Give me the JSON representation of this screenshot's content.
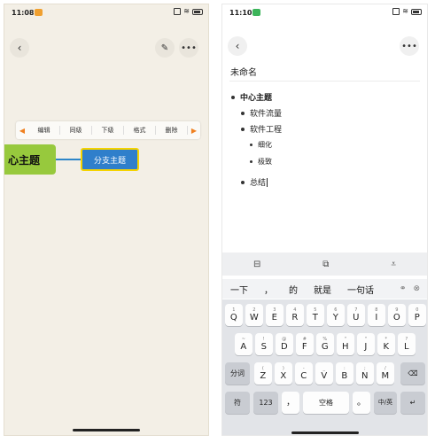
{
  "left_phone": {
    "status": {
      "time": "11:08"
    },
    "toolbar": {
      "items": [
        "编辑",
        "同级",
        "下级",
        "格式",
        "删除"
      ]
    },
    "nodes": {
      "main": "心主题",
      "branch": "分支主题"
    },
    "icons": {
      "back": "chevron-left-icon",
      "style": "brush-icon",
      "more": "more-icon"
    }
  },
  "right_phone": {
    "status": {
      "time": "11:10"
    },
    "doc_title": "未命名",
    "outline": {
      "center": "中心主题",
      "traffic": "软件流量",
      "engineering": "软件工程",
      "refine": "细化",
      "extreme": "极致",
      "summary": "总结"
    },
    "ime_toolbar": [
      "layout-icon",
      "clipboard-icon",
      "collapse-icon"
    ],
    "candidates": [
      "一下",
      "，",
      "的",
      "就是",
      "一句话"
    ],
    "keyboard": {
      "row1": [
        {
          "k": "Q",
          "s": "1"
        },
        {
          "k": "W",
          "s": "2"
        },
        {
          "k": "E",
          "s": "3"
        },
        {
          "k": "R",
          "s": "4"
        },
        {
          "k": "T",
          "s": "5"
        },
        {
          "k": "Y",
          "s": "6"
        },
        {
          "k": "U",
          "s": "7"
        },
        {
          "k": "I",
          "s": "8"
        },
        {
          "k": "O",
          "s": "9"
        },
        {
          "k": "P",
          "s": "0"
        }
      ],
      "row2": [
        {
          "k": "A",
          "s": "~"
        },
        {
          "k": "S",
          "s": "!"
        },
        {
          "k": "D",
          "s": "@"
        },
        {
          "k": "F",
          "s": "#"
        },
        {
          "k": "G",
          "s": "%"
        },
        {
          "k": "H",
          "s": "\""
        },
        {
          "k": "J",
          "s": "\""
        },
        {
          "k": "K",
          "s": "*"
        },
        {
          "k": "L",
          "s": "?"
        }
      ],
      "row3_left": "分词",
      "row3": [
        {
          "k": "Z",
          "s": "("
        },
        {
          "k": "X",
          "s": ")"
        },
        {
          "k": "C",
          "s": "-"
        },
        {
          "k": "V",
          "s": "_"
        },
        {
          "k": "B",
          "s": ":"
        },
        {
          "k": "N",
          "s": ";"
        },
        {
          "k": "M",
          "s": "/"
        }
      ],
      "row4": {
        "symbol": "符",
        "number": "123",
        "comma": "，",
        "space": "空格",
        "period": "。",
        "lang": "中/英"
      }
    }
  }
}
